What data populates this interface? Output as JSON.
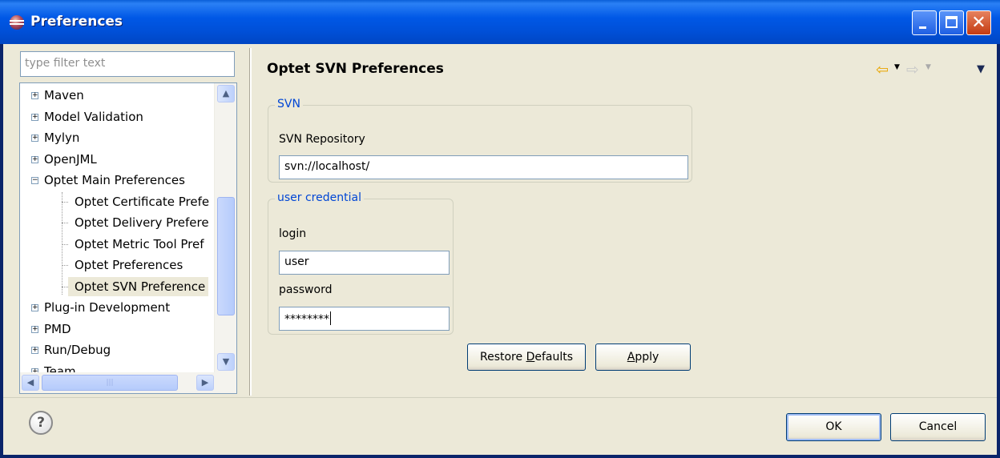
{
  "window": {
    "title": "Preferences"
  },
  "filter": {
    "placeholder": "type filter text"
  },
  "tree": {
    "items": [
      {
        "label": "Maven",
        "expander": "+"
      },
      {
        "label": "Model Validation",
        "expander": "+"
      },
      {
        "label": "Mylyn",
        "expander": "+"
      },
      {
        "label": "OpenJML",
        "expander": "+"
      },
      {
        "label": "Optet Main Preferences",
        "expander": "−"
      },
      {
        "label": "Optet Certificate Prefe"
      },
      {
        "label": "Optet Delivery Prefere"
      },
      {
        "label": "Optet Metric Tool Pref"
      },
      {
        "label": "Optet Preferences"
      },
      {
        "label": "Optet SVN Preference",
        "selected": true
      },
      {
        "label": "Plug-in Development",
        "expander": "+"
      },
      {
        "label": "PMD",
        "expander": "+"
      },
      {
        "label": "Run/Debug",
        "expander": "+"
      },
      {
        "label": "Team",
        "expander": "+"
      }
    ]
  },
  "page": {
    "title": "Optet SVN Preferences",
    "svn_group": {
      "legend": "SVN",
      "repo_label": "SVN Repository",
      "repo_value": "svn://localhost/"
    },
    "cred_group": {
      "legend": "user credential",
      "login_label": "login",
      "login_value": "user",
      "password_label": "password",
      "password_value": "********"
    },
    "restore_defaults": {
      "pre": "Restore ",
      "mnemonic": "D",
      "post": "efaults"
    },
    "apply": {
      "mnemonic": "A",
      "post": "pply"
    }
  },
  "nav": {
    "back_icon": "arrow-left-icon",
    "forward_icon": "arrow-right-icon",
    "menu_icon": "view-menu-icon"
  },
  "footer": {
    "ok": "OK",
    "cancel": "Cancel",
    "help_glyph": "?"
  },
  "colors": {
    "title_bar": "#0054e3",
    "group_legend": "#0046d5",
    "dialog_bg": "#ece9d8"
  }
}
